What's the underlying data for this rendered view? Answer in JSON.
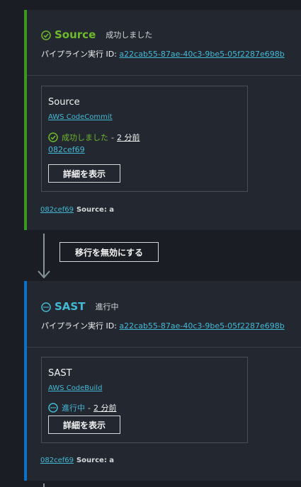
{
  "stages": [
    {
      "name": "Source",
      "status": "成功しました",
      "exec_label": "パイプライン実行 ID:",
      "exec_id": "a22cab55-87ae-40c3-9be5-05f2287e698b",
      "action": {
        "name": "Source",
        "provider": "AWS CodeCommit",
        "status": "成功しました",
        "separator": "-",
        "time": "2 分前",
        "commit": "082cef69",
        "details_button": "詳細を表示"
      },
      "footer": {
        "commit": "082cef69",
        "message": "Source: a"
      },
      "icon": "check-circle-icon",
      "color": "#3b9a1e"
    },
    {
      "name": "SAST",
      "status": "進行中",
      "exec_label": "パイプライン実行 ID:",
      "exec_id": "a22cab55-87ae-40c3-9be5-05f2287e698b",
      "action": {
        "name": "SAST",
        "provider": "AWS CodeBuild",
        "status": "進行中",
        "separator": "-",
        "time": "2 分前",
        "details_button": "詳細を表示"
      },
      "footer": {
        "commit": "082cef69",
        "message": "Source: a"
      },
      "icon": "in-progress-icon",
      "color": "#0a73c9"
    }
  ],
  "transition": {
    "disable_button": "移行を無効にする"
  }
}
